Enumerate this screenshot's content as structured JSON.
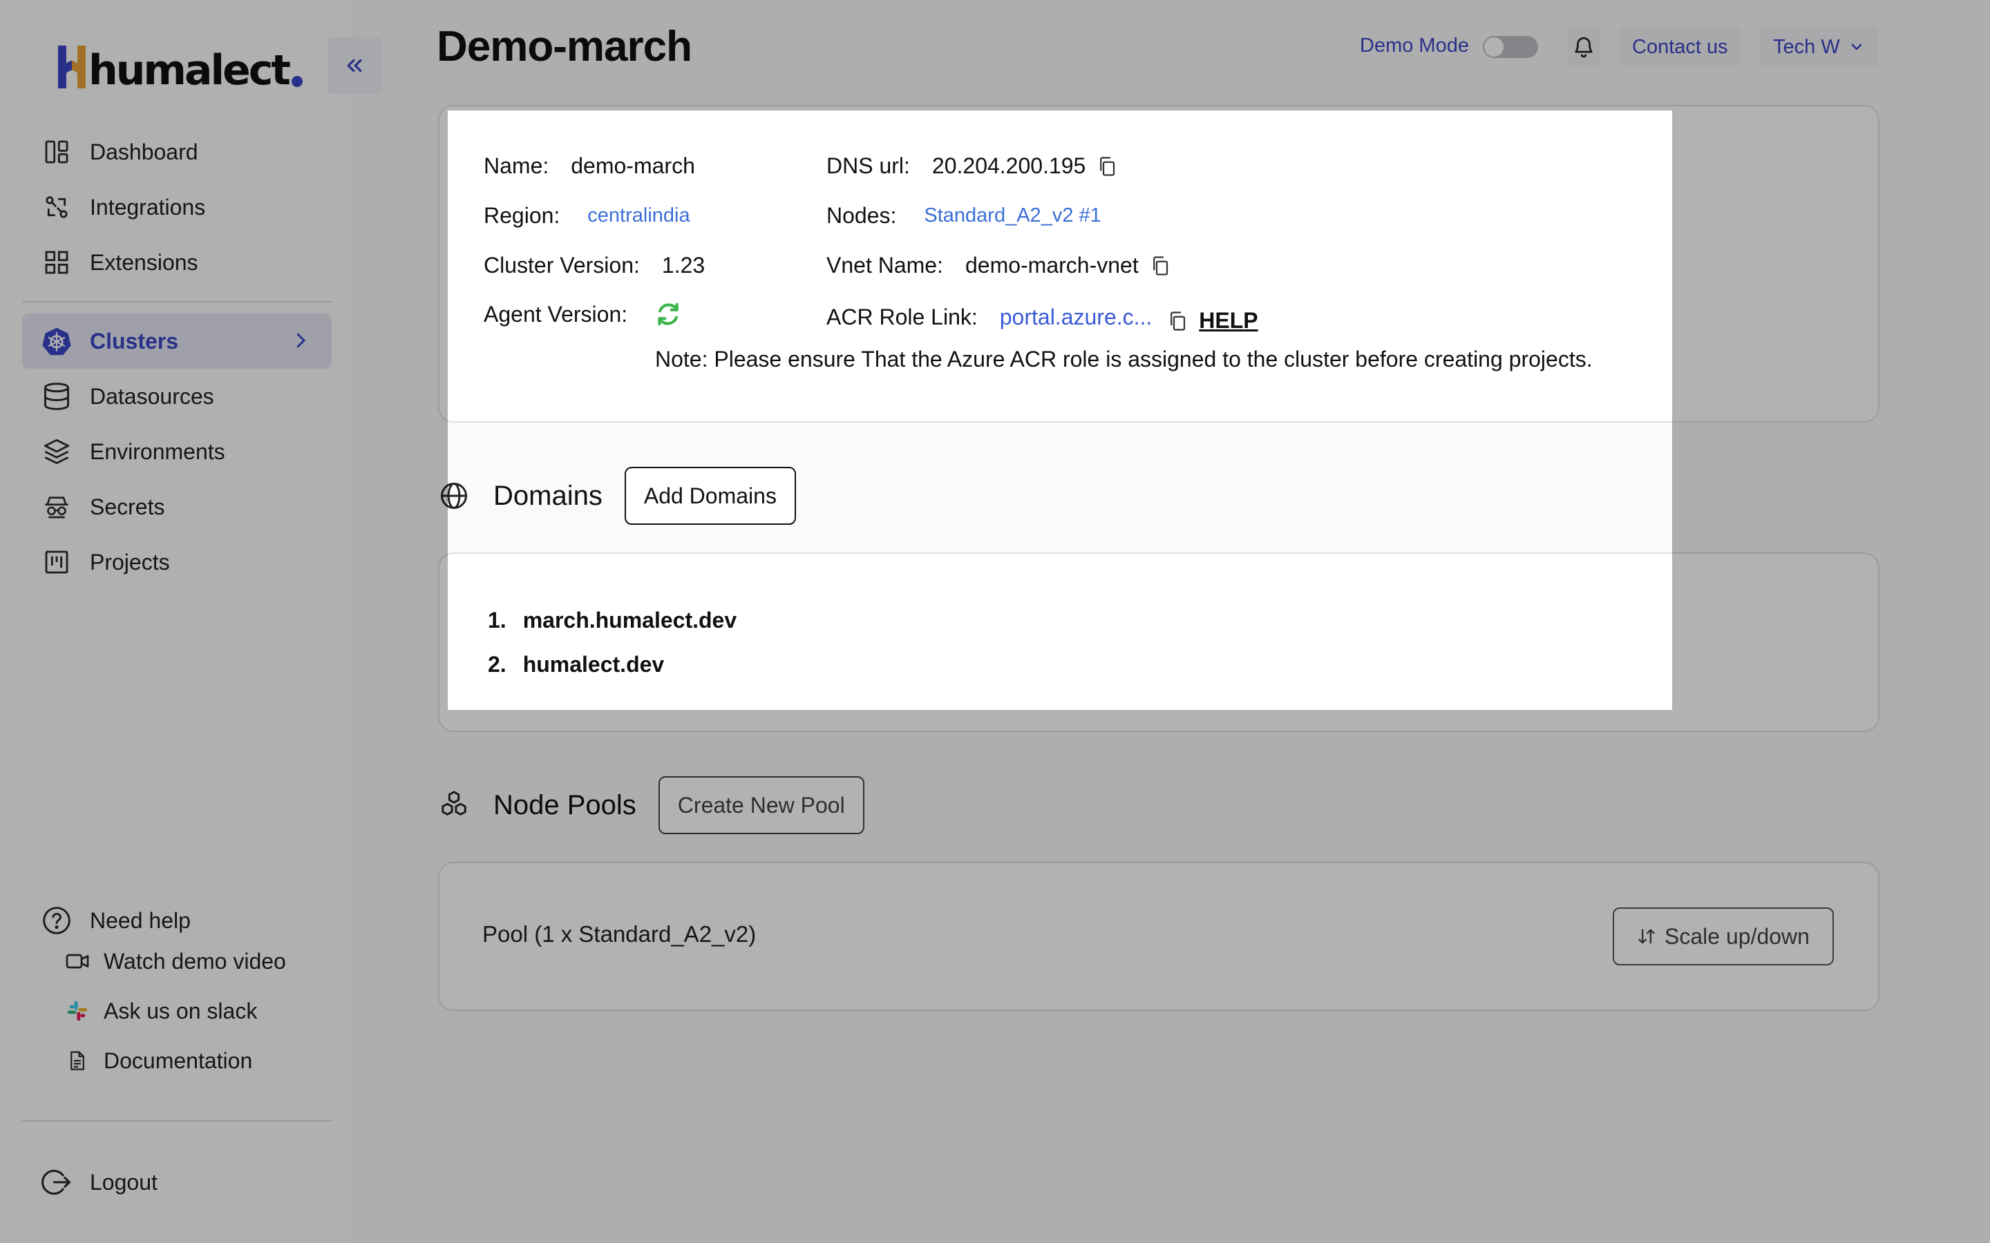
{
  "brand": {
    "logo_text": "humalect"
  },
  "sidebar": {
    "nav": [
      {
        "label": "Dashboard",
        "icon": "dashboard-icon"
      },
      {
        "label": "Integrations",
        "icon": "integrations-icon"
      },
      {
        "label": "Extensions",
        "icon": "extensions-icon"
      }
    ],
    "nav2": [
      {
        "label": "Clusters",
        "icon": "kubernetes-icon",
        "active": true
      },
      {
        "label": "Datasources",
        "icon": "database-icon"
      },
      {
        "label": "Environments",
        "icon": "layers-icon"
      },
      {
        "label": "Secrets",
        "icon": "secrets-icon"
      },
      {
        "label": "Projects",
        "icon": "projects-icon"
      }
    ],
    "help": {
      "label": "Need help",
      "items": [
        {
          "label": "Watch demo video",
          "icon": "video-icon"
        },
        {
          "label": "Ask us on slack",
          "icon": "slack-icon"
        },
        {
          "label": "Documentation",
          "icon": "document-icon"
        }
      ]
    },
    "logout": "Logout"
  },
  "header": {
    "title": "Demo-march",
    "demo_mode": "Demo Mode",
    "demo_mode_on": false,
    "contact": "Contact us",
    "user": "Tech W"
  },
  "cluster": {
    "name_label": "Name:",
    "name": "demo-march",
    "region_label": "Region:",
    "region": "centralindia",
    "version_label": "Cluster Version:",
    "version": "1.23",
    "agent_label": "Agent Version:",
    "dns_label": "DNS url:",
    "dns": "20.204.200.195",
    "nodes_label": "Nodes:",
    "nodes": "Standard_A2_v2 #1",
    "vnet_label": "Vnet Name:",
    "vnet": "demo-march-vnet",
    "acr_label": "ACR Role Link:",
    "acr": "portal.azure.c...",
    "help": "HELP",
    "note": "Note: Please ensure That the Azure ACR role is assigned to the cluster before creating projects."
  },
  "domains": {
    "title": "Domains",
    "add_button": "Add Domains",
    "items": [
      {
        "num": "1.",
        "name": "march.humalect.dev"
      },
      {
        "num": "2.",
        "name": "humalect.dev"
      }
    ]
  },
  "node_pools": {
    "title": "Node Pools",
    "create_button": "Create New Pool",
    "pool": "Pool (1 x Standard_A2_v2)",
    "scale_button": "Scale up/down"
  },
  "colors": {
    "accent": "#3b46c4",
    "link": "#3b5bd6",
    "agent_ok": "#3bb54a"
  }
}
